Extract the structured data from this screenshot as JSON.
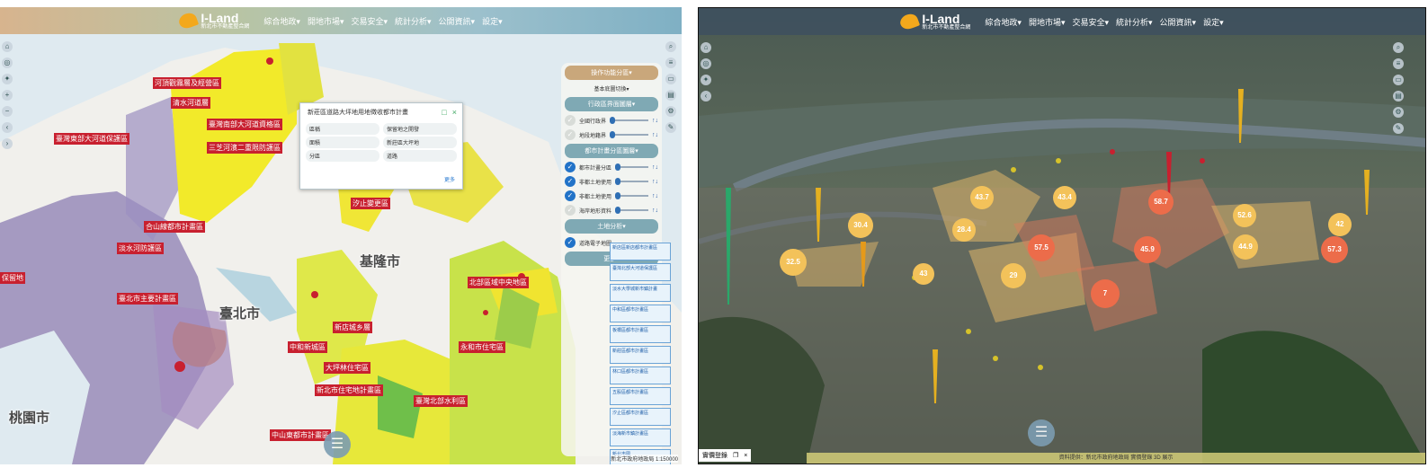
{
  "header": {
    "app_name": "I-Land",
    "app_subtitle": "新北市不動產整合網",
    "menu": [
      "綜合地政▾",
      "開地市場▾",
      "交易安全▾",
      "統計分析▾",
      "公開資訊▾",
      "設定▾"
    ]
  },
  "left_map": {
    "cities": [
      "臺北市",
      "基隆市",
      "桃園市"
    ],
    "labels": [
      "河頂觀霧層及經營區",
      "清水河道層",
      "臺灣南部大河道資格區",
      "三芝河濱二重限防護區",
      "合山線都市計畫區",
      "淡水河防護區",
      "保留地",
      "臺北市主要計畫區",
      "汐止變更區",
      "新店城乡層",
      "中和新城區",
      "大坪林住宅區",
      "新北市住宅地計畫區",
      "北部區域中央地區",
      "中山東都市計畫區",
      "臺灣北部水利區",
      "永和市住宅區",
      "臺灣東部大河道保護區"
    ],
    "popup": {
      "title": "新莊區道路大坪地用地徵收都市計畫",
      "rows": [
        [
          "區稱",
          "保留地之開發"
        ],
        [
          "面積",
          "新莊區大坪地"
        ],
        [
          "分區",
          "道路"
        ]
      ],
      "more": "更多"
    },
    "side_panel": {
      "section1": "操作功能分區▾",
      "section1_sub": "基本底圖切換▾",
      "section2": "行政區界面圖層▾",
      "layers_a": [
        {
          "label": "全國行政界",
          "on": false
        },
        {
          "label": "地段地籍界",
          "on": false
        }
      ],
      "section3": "都市計畫分區圖層▾",
      "layers_b": [
        {
          "label": "都市計畫分區",
          "on": true
        },
        {
          "label": "非都土地使用",
          "on": true
        },
        {
          "label": "非都土地使用",
          "on": true
        },
        {
          "label": "海岸地形資料",
          "on": false
        }
      ],
      "section4": "土地分析▾",
      "layers_c": [
        {
          "label": "道路電子地圖",
          "on": true
        }
      ],
      "section5": "更多▾"
    },
    "plan_list": [
      "新店區新店都市計畫區",
      "臺灣北部大河道保護區",
      "淡水大學城新市鎮計畫",
      "中和區都市計畫區",
      "板橋區都市計畫區",
      "新莊區都市計畫區",
      "林口區都市計畫區",
      "五股區都市計畫區",
      "汐止區都市計畫區",
      "淡海新市鎮計畫區",
      "新北市國",
      "圖例"
    ],
    "footer": "新北市政府地政局 1:150000"
  },
  "right_map": {
    "clusters": [
      {
        "value": "43.7",
        "color": "#f3c25a"
      },
      {
        "value": "43.4",
        "color": "#f3c25a"
      },
      {
        "value": "58.7",
        "color": "#ec6c4a"
      },
      {
        "value": "30.4",
        "color": "#f3c25a"
      },
      {
        "value": "28.4",
        "color": "#f3c25a"
      },
      {
        "value": "52.6",
        "color": "#f3c25a"
      },
      {
        "value": "42",
        "color": "#f3c25a"
      },
      {
        "value": "32.5",
        "color": "#f3c25a"
      },
      {
        "value": "57.5",
        "color": "#ec6c4a"
      },
      {
        "value": "45.9",
        "color": "#ec6c4a"
      },
      {
        "value": "44.9",
        "color": "#f3c25a"
      },
      {
        "value": "57.3",
        "color": "#ec6c4a"
      },
      {
        "value": "29",
        "color": "#f3c25a"
      },
      {
        "value": "7",
        "color": "#ec6c4a"
      },
      {
        "value": "43",
        "color": "#f3c25a"
      }
    ],
    "bottom_tab": "實價登錄",
    "footer": "資料提供：新北市政府地政局 實價登錄 3D 展示"
  },
  "colors": {
    "accent": "#2273c8",
    "header": "#3c4e60"
  }
}
